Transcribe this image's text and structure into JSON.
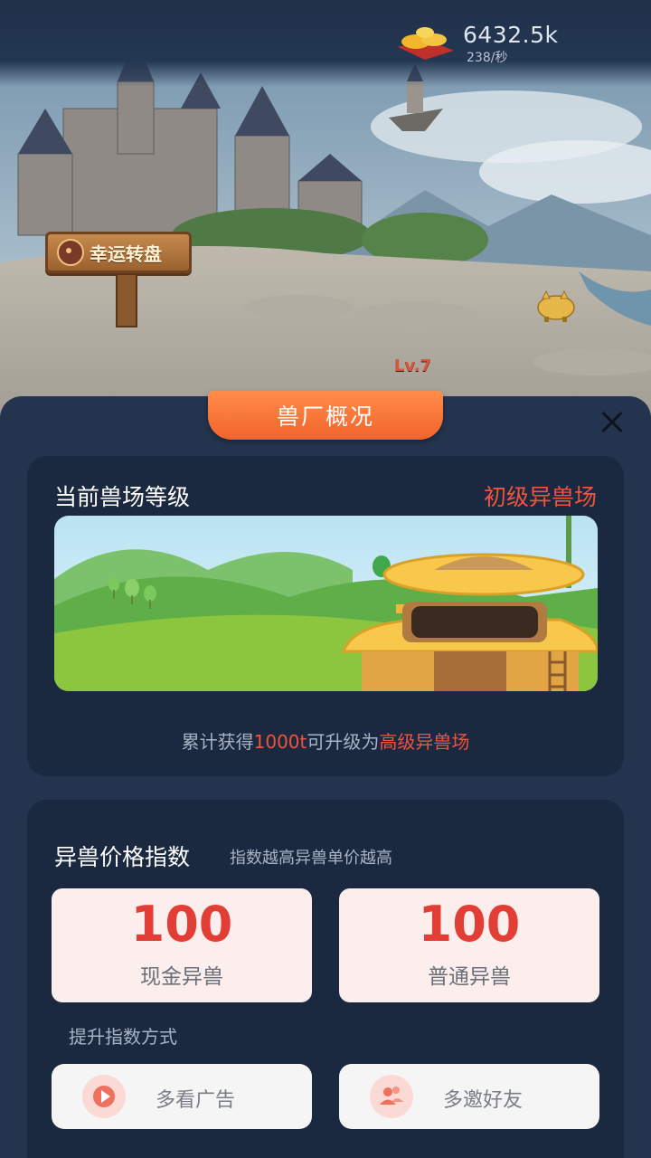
{
  "header": {
    "coin_value": "6432.5k",
    "coin_rate": "238/秒",
    "coin_icon": "gold-ingot-icon"
  },
  "scene": {
    "sign_text": "幸运转盘",
    "level_tag": "Lv.7"
  },
  "panel": {
    "tab_title": "兽厂概况",
    "close_icon": "close-icon",
    "accent_color": "#f2632a",
    "highlight_color": "#f1533d"
  },
  "level_card": {
    "title": "当前兽场等级",
    "level_name": "初级异兽场",
    "upgrade_prefix": "累计获得",
    "upgrade_amount": "1000t",
    "upgrade_middle": "可升级为",
    "upgrade_target": "高级异兽场"
  },
  "price_card": {
    "title": "异兽价格指数",
    "subtitle": "指数越高异兽单价越高",
    "indices": [
      {
        "value": "100",
        "label": "现金异兽"
      },
      {
        "value": "100",
        "label": "普通异兽"
      }
    ],
    "method_title": "提升指数方式",
    "methods": [
      {
        "label": "多看广告",
        "icon": "play-video-icon"
      },
      {
        "label": "多邀好友",
        "icon": "invite-friends-icon"
      }
    ]
  }
}
